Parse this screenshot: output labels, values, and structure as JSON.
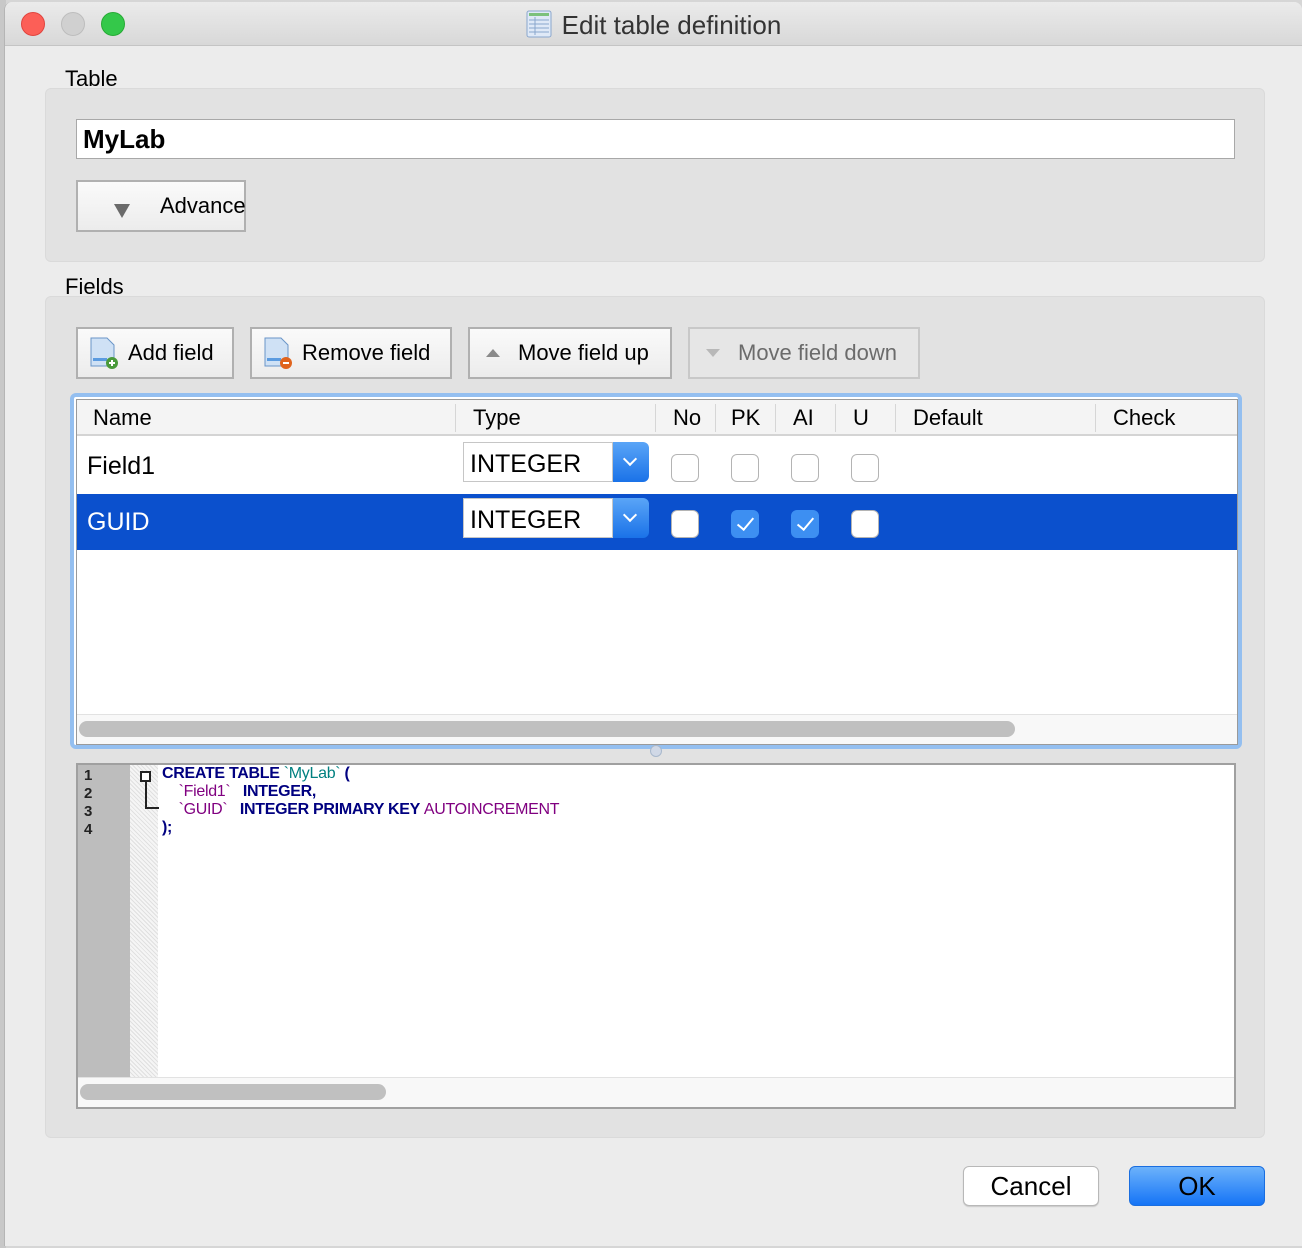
{
  "window": {
    "title": "Edit table definition",
    "title_icon": "table-icon"
  },
  "table_group": {
    "label": "Table",
    "name_value": "MyLab",
    "advance_label": "Advance"
  },
  "fields_group": {
    "label": "Fields",
    "toolbar": {
      "add": {
        "label": "Add field",
        "icon": "add-field-icon",
        "enabled": true
      },
      "remove": {
        "label": "Remove field",
        "icon": "remove-field-icon",
        "enabled": true
      },
      "up": {
        "label": "Move field up",
        "icon": "arrow-up-icon",
        "enabled": true
      },
      "down": {
        "label": "Move field down",
        "icon": "arrow-down-icon",
        "enabled": false
      }
    },
    "columns": [
      "Name",
      "Type",
      "No",
      "PK",
      "AI",
      "U",
      "Default",
      "Check"
    ],
    "rows": [
      {
        "name": "Field1",
        "type": "INTEGER",
        "not_null": false,
        "pk": false,
        "ai": false,
        "unique": false,
        "default": "",
        "check": "",
        "selected": false
      },
      {
        "name": "GUID",
        "type": "INTEGER",
        "not_null": false,
        "pk": true,
        "ai": true,
        "unique": false,
        "default": "",
        "check": "",
        "selected": true
      }
    ]
  },
  "sql_preview": {
    "line_numbers": [
      "1",
      "2",
      "3",
      "4"
    ],
    "lines": [
      {
        "kw": "CREATE TABLE ",
        "ident": "`MyLab`",
        "rest": " ("
      },
      {
        "indent": "    ",
        "field": "`Field1`",
        "kw": "   INTEGER,"
      },
      {
        "indent": "    ",
        "field": "`GUID`",
        "kw": "   INTEGER PRIMARY KEY ",
        "kw2": "AUTOINCREMENT"
      },
      {
        "kw": ");"
      }
    ]
  },
  "buttons": {
    "cancel": "Cancel",
    "ok": "OK"
  },
  "colors": {
    "selection": "#0b50cd",
    "focus_ring": "#94bff0",
    "accent": "#1574f6"
  }
}
